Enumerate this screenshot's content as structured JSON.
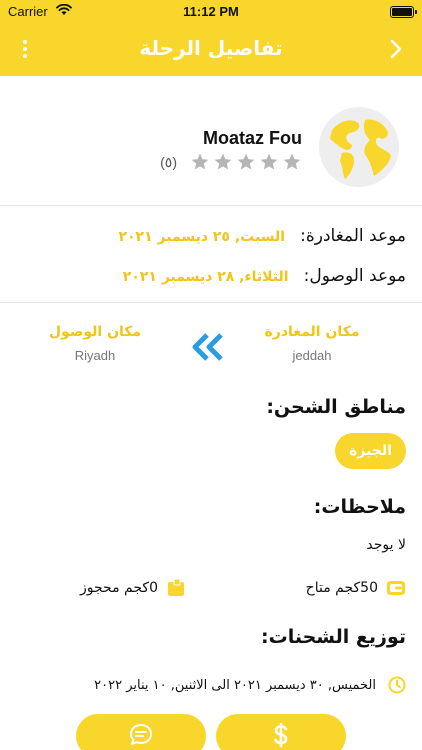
{
  "status_bar": {
    "carrier": "Carrier",
    "time": "11:12 PM"
  },
  "header": {
    "title": "تفاصيل الرحلة"
  },
  "profile": {
    "name": "Moataz Fou",
    "rating_count": "(٥)",
    "rating_value": 0,
    "rating_max": 5
  },
  "schedule": {
    "departure_label": "موعد المغادرة:",
    "departure_value": "السبت, ٢٥ ديسمبر ٢٠٢١",
    "arrival_label": "موعد الوصول:",
    "arrival_value": "الثلاثاء, ٢٨ ديسمبر ٢٠٢١"
  },
  "route": {
    "from_label": "مكان المغادرة",
    "from_city": "jeddah",
    "to_label": "مكان الوصول",
    "to_city": "Riyadh"
  },
  "shipping_areas": {
    "title": "مناطق الشحن:",
    "areas": [
      "الجيزة"
    ]
  },
  "notes": {
    "title": "ملاحظات:",
    "text": "لا يوجد"
  },
  "capacity": {
    "available": "50كجم متاح",
    "reserved": "0كجم محجوز"
  },
  "distribution": {
    "title": "توزيع الشحنات:",
    "text": "الخميس, ٣٠ ديسمبر ٢٠٢١  الى  الاثنين, ١٠ يناير ٢٠٢٢"
  },
  "colors": {
    "accent": "#f9d62b",
    "accent_text": "#f2c418",
    "arrow_blue": "#2a9de0"
  },
  "icons": {
    "back": "chevron-right-icon",
    "menu": "more-vertical-icon",
    "avatar": "globe-icon",
    "star": "star-icon",
    "direction": "double-chevron-left-icon",
    "available": "wallet-icon",
    "reserved": "package-icon",
    "clock": "clock-icon",
    "chat": "chat-icon",
    "price": "dollar-icon"
  }
}
